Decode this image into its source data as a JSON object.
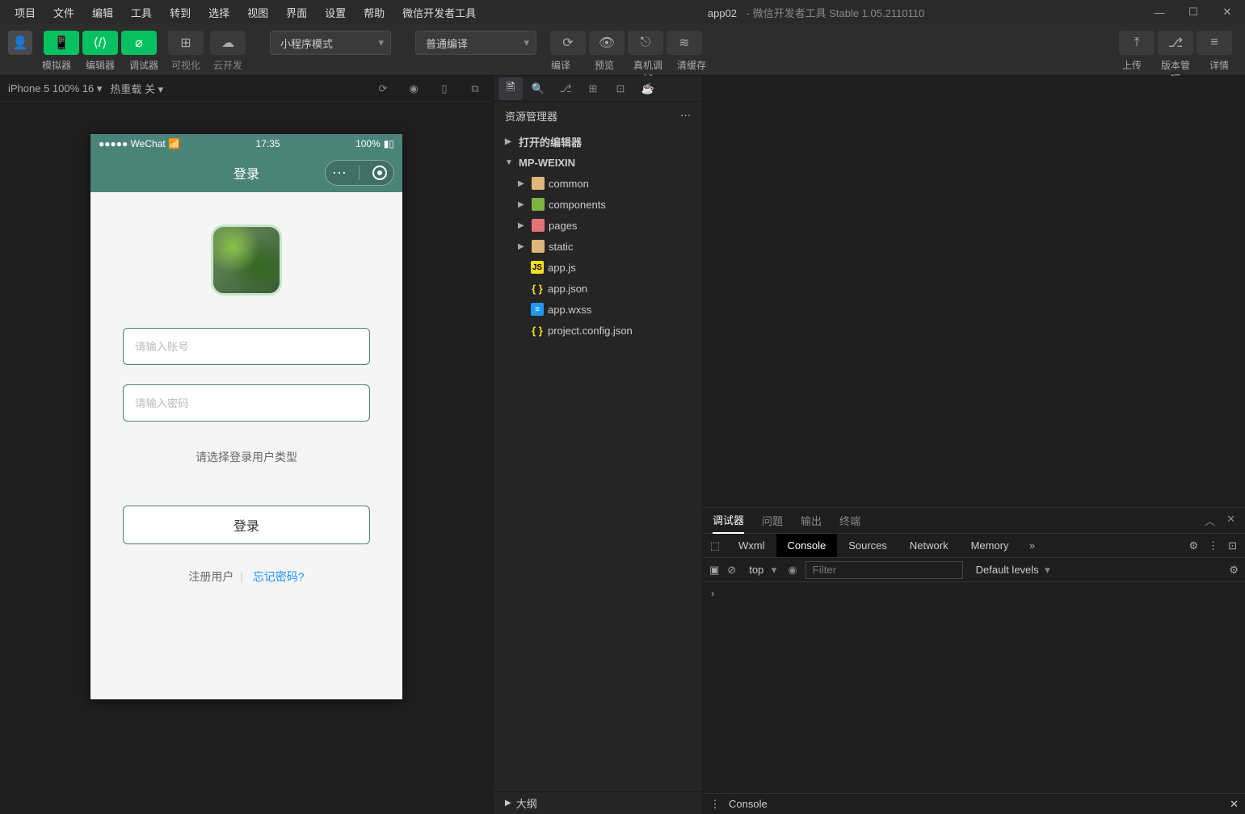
{
  "menu": [
    "项目",
    "文件",
    "编辑",
    "工具",
    "转到",
    "选择",
    "视图",
    "界面",
    "设置",
    "帮助",
    "微信开发者工具"
  ],
  "title": {
    "app": "app02",
    "suffix": "微信开发者工具 Stable 1.05.2110110"
  },
  "toolbar": {
    "labels": {
      "simulator": "模拟器",
      "editor": "编辑器",
      "debugger": "调试器",
      "visualize": "可视化",
      "cloud": "云开发"
    },
    "mode": "小程序模式",
    "compile_mode": "普通编译",
    "actions": {
      "compile": "编译",
      "preview": "预览",
      "remote": "真机调试",
      "clear": "清缓存",
      "upload": "上传",
      "version": "版本管理",
      "details": "详情"
    }
  },
  "simHeader": {
    "device": "iPhone 5 100% 16 ▾",
    "hotreload": "热重载 关 ▾"
  },
  "phone": {
    "status": {
      "left": "●●●●● WeChat ⁠",
      "wifi": "≈",
      "time": "17:35",
      "battery": "100%"
    },
    "nav_title": "登录",
    "account_ph": "请输入账号",
    "password_ph": "请输入密码",
    "select_type": "请选择登录用户类型",
    "login_btn": "登录",
    "register": "注册用户",
    "forgot": "忘记密码?"
  },
  "explorer": {
    "title": "资源管理器",
    "open_editors": "打开的编辑器",
    "project": "MP-WEIXIN",
    "folders": [
      {
        "name": "common",
        "cls": "folder"
      },
      {
        "name": "components",
        "cls": "folder-green"
      },
      {
        "name": "pages",
        "cls": "folder-red"
      },
      {
        "name": "static",
        "cls": "folder"
      }
    ],
    "files": [
      {
        "name": "app.js",
        "cls": "js",
        "tag": "JS"
      },
      {
        "name": "app.json",
        "cls": "json",
        "tag": "{ }"
      },
      {
        "name": "app.wxss",
        "cls": "wxss",
        "tag": "≡"
      },
      {
        "name": "project.config.json",
        "cls": "json",
        "tag": "{ }"
      }
    ],
    "outline": "大纲"
  },
  "debugger": {
    "tabs": [
      "调试器",
      "问题",
      "输出",
      "终端"
    ],
    "devtools_tabs": [
      "Wxml",
      "Console",
      "Sources",
      "Network",
      "Memory"
    ],
    "top": "top",
    "filter_ph": "Filter",
    "levels": "Default levels",
    "prompt": "›",
    "footer": "Console"
  }
}
